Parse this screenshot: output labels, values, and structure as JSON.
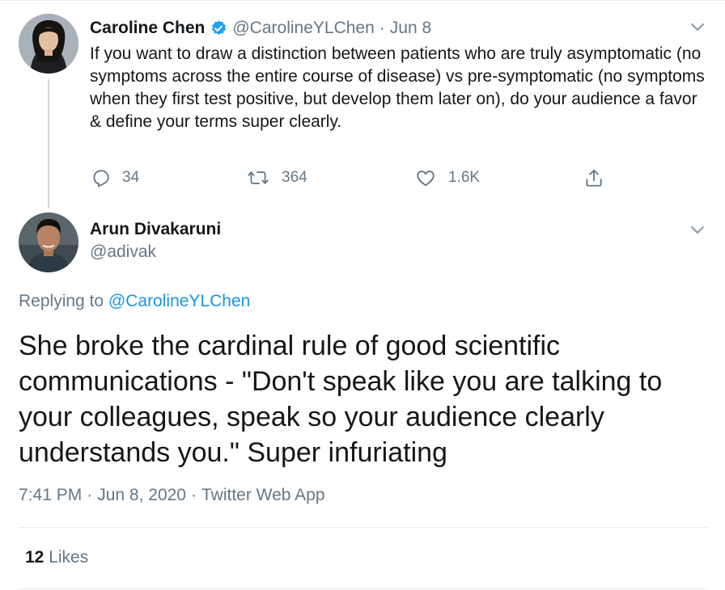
{
  "parent_tweet": {
    "author_name": "Caroline Chen",
    "author_handle": "@CarolineYLChen",
    "separator": "·",
    "date": "Jun 8",
    "text": "If you want to draw a distinction between patients who are truly asymptomatic (no symptoms across the entire course of disease) vs pre-symptomatic (no symptoms when they first test positive, but develop them later on), do your audience a favor & define your terms super clearly.",
    "reply_count": "34",
    "retweet_count": "364",
    "like_count": "1.6K",
    "verified": true
  },
  "main_tweet": {
    "author_name": "Arun Divakaruni",
    "author_handle": "@adivak",
    "replying_prefix": "Replying to ",
    "replying_to": "@CarolineYLChen",
    "text": "She broke the cardinal rule of good scientific communications - \"Don't speak like you are talking to your colleagues, speak so your audience clearly understands you.\"  Super infuriating",
    "time": "7:41 PM",
    "date": "Jun 8, 2020",
    "source": "Twitter Web App",
    "separator": "·",
    "likes_count": "12",
    "likes_label": "Likes"
  },
  "colors": {
    "text": "#14171a",
    "secondary": "#657786",
    "link": "#1b95e0",
    "divider": "#e6ecf0",
    "thread_line": "#ccd6dd"
  },
  "icons": {
    "more": "chevron-down-icon",
    "verified": "verified-badge-icon",
    "reply": "reply-icon",
    "retweet": "retweet-icon",
    "like": "heart-icon",
    "share": "share-icon"
  }
}
